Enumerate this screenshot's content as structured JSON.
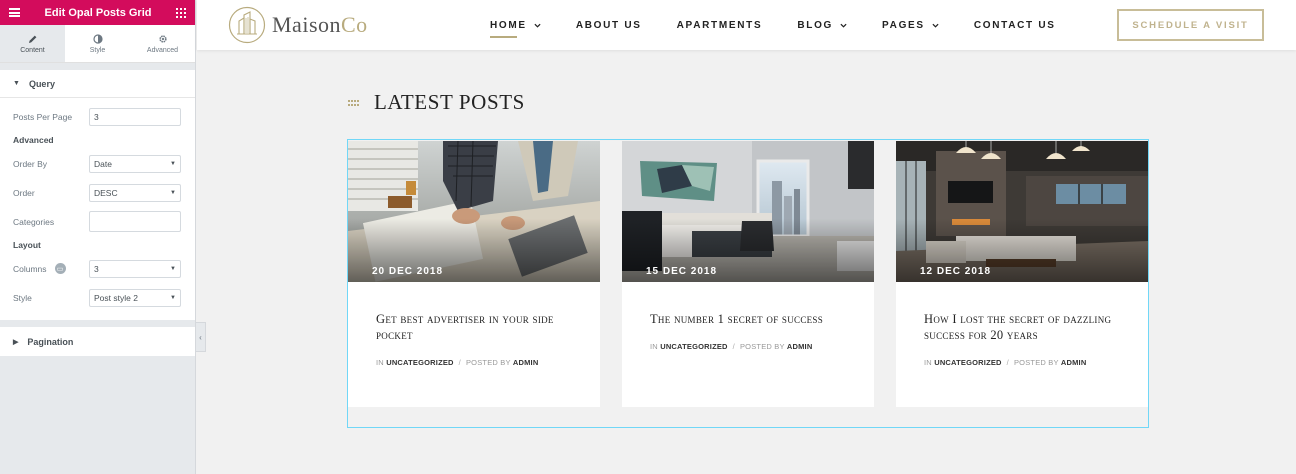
{
  "editor": {
    "title": "Edit Opal Posts Grid",
    "tabs": [
      {
        "label": "Content",
        "icon": "pencil-icon"
      },
      {
        "label": "Style",
        "icon": "half-circle-icon"
      },
      {
        "label": "Advanced",
        "icon": "gear-icon"
      }
    ],
    "query": {
      "heading": "Query",
      "posts_per_page_label": "Posts Per Page",
      "posts_per_page_value": "3",
      "advanced_heading": "Advanced",
      "order_by_label": "Order By",
      "order_by_value": "Date",
      "order_label": "Order",
      "order_value": "DESC",
      "categories_label": "Categories",
      "categories_value": "",
      "layout_heading": "Layout",
      "columns_label": "Columns",
      "columns_value": "3",
      "style_label": "Style",
      "style_value": "Post style 2"
    },
    "pagination_heading": "Pagination"
  },
  "site": {
    "logo": {
      "main": "Maison",
      "accent": "Co"
    },
    "nav": [
      {
        "label": "HOME",
        "dropdown": true,
        "active": true
      },
      {
        "label": "ABOUT US",
        "dropdown": false
      },
      {
        "label": "APARTMENTS",
        "dropdown": false
      },
      {
        "label": "BLOG",
        "dropdown": true
      },
      {
        "label": "PAGES",
        "dropdown": true
      },
      {
        "label": "CONTACT US",
        "dropdown": false
      }
    ],
    "cta": "SCHEDULE A VISIT",
    "accent_color": "#b8ab7e",
    "brand_color": "#d30c5c"
  },
  "latest_posts": {
    "heading": "LATEST POSTS",
    "posts": [
      {
        "date": "20 DEC 2018",
        "title": "Get best advertiser in your side pocket",
        "in_label": "IN",
        "category": "UNCATEGORIZED",
        "by_label": "POSTED BY",
        "author": "ADMIN"
      },
      {
        "date": "15 DEC 2018",
        "title": "The number 1 secret of success",
        "in_label": "IN",
        "category": "UNCATEGORIZED",
        "by_label": "POSTED BY",
        "author": "ADMIN"
      },
      {
        "date": "12 DEC 2018",
        "title": "How I lost the secret of dazzling success for 20 years",
        "in_label": "IN",
        "category": "UNCATEGORIZED",
        "by_label": "POSTED BY",
        "author": "ADMIN"
      }
    ]
  }
}
